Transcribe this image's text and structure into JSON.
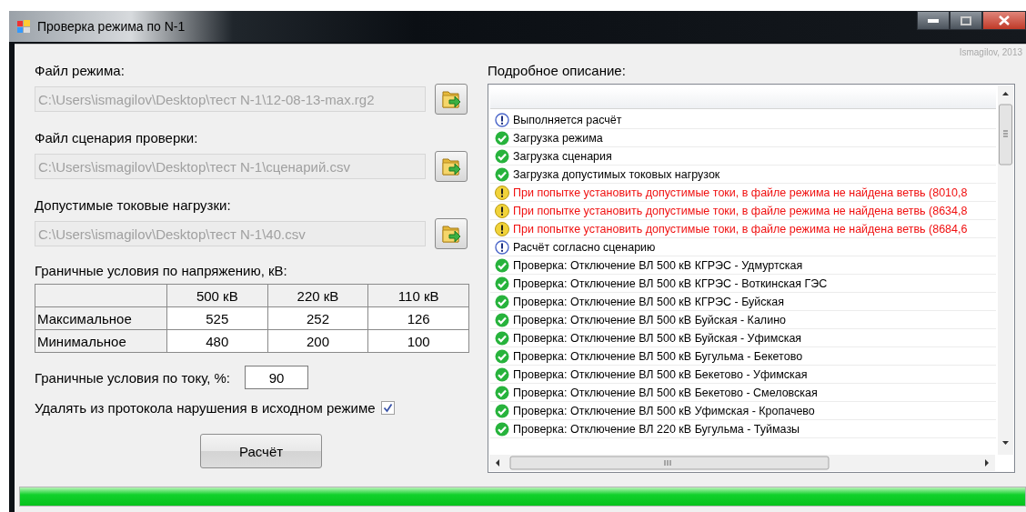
{
  "window": {
    "title": "Проверка режима по N-1",
    "author_label": "Ismagilov, 2013"
  },
  "files": [
    {
      "label": "Файл режима:",
      "value": "C:\\Users\\ismagilov\\Desktop\\тест N-1\\12-08-13-max.rg2",
      "disabled": true
    },
    {
      "label": "Файл сценария проверки:",
      "value": "C:\\Users\\ismagilov\\Desktop\\тест N-1\\сценарий.csv",
      "disabled": true
    },
    {
      "label": "Допустимые токовые нагрузки:",
      "value": "C:\\Users\\ismagilov\\Desktop\\тест N-1\\40.csv",
      "disabled": true
    }
  ],
  "voltage_limits": {
    "label": "Граничные условия по напряжению, кВ:",
    "columns": [
      "500 кВ",
      "220 кВ",
      "110 кВ"
    ],
    "rows": [
      {
        "name": "Максимальное",
        "values": [
          "525",
          "252",
          "126"
        ]
      },
      {
        "name": "Минимальное",
        "values": [
          "480",
          "200",
          "100"
        ]
      }
    ]
  },
  "current_limit": {
    "label": "Граничные условия по току, %:",
    "value": "90"
  },
  "remove_violations": {
    "label": "Удалять из протокола нарушения в исходном режиме",
    "checked": true
  },
  "calculate_button": "Расчёт",
  "log": {
    "label": "Подробное описание:",
    "items": [
      {
        "kind": "info",
        "text": "Выполняется расчёт"
      },
      {
        "kind": "ok",
        "text": "Загрузка режима"
      },
      {
        "kind": "ok",
        "text": "Загрузка сценария"
      },
      {
        "kind": "ok",
        "text": "Загрузка допустимых токовых нагрузок"
      },
      {
        "kind": "warn",
        "text": "При попытке установить допустимые токи, в файле режима не найдена ветвь (8010,8"
      },
      {
        "kind": "warn",
        "text": "При попытке установить допустимые токи, в файле режима не найдена ветвь (8634,8"
      },
      {
        "kind": "warn",
        "text": "При попытке установить допустимые токи, в файле режима не найдена ветвь (8684,6"
      },
      {
        "kind": "info",
        "text": "Расчёт согласно сценарию"
      },
      {
        "kind": "ok",
        "text": "Проверка: Отключение ВЛ 500 кВ КГРЭС - Удмуртская"
      },
      {
        "kind": "ok",
        "text": "Проверка: Отключение ВЛ 500 кВ КГРЭС - Воткинская ГЭС"
      },
      {
        "kind": "ok",
        "text": "Проверка: Отключение ВЛ 500 кВ КГРЭС - Буйская"
      },
      {
        "kind": "ok",
        "text": "Проверка: Отключение ВЛ 500 кВ Буйская - Калино"
      },
      {
        "kind": "ok",
        "text": "Проверка: Отключение ВЛ 500 кВ Буйская - Уфимская"
      },
      {
        "kind": "ok",
        "text": "Проверка: Отключение ВЛ 500 кВ Бугульма - Бекетово"
      },
      {
        "kind": "ok",
        "text": "Проверка: Отключение ВЛ 500 кВ Бекетово - Уфимская"
      },
      {
        "kind": "ok",
        "text": "Проверка: Отключение ВЛ 500 кВ Бекетово - Смеловская"
      },
      {
        "kind": "ok",
        "text": "Проверка: Отключение ВЛ 500 кВ Уфимская - Кропачево"
      },
      {
        "kind": "ok",
        "text": "Проверка: Отключение ВЛ 220 кВ Бугульма - Туймазы"
      }
    ]
  },
  "progress": {
    "level": 1
  }
}
